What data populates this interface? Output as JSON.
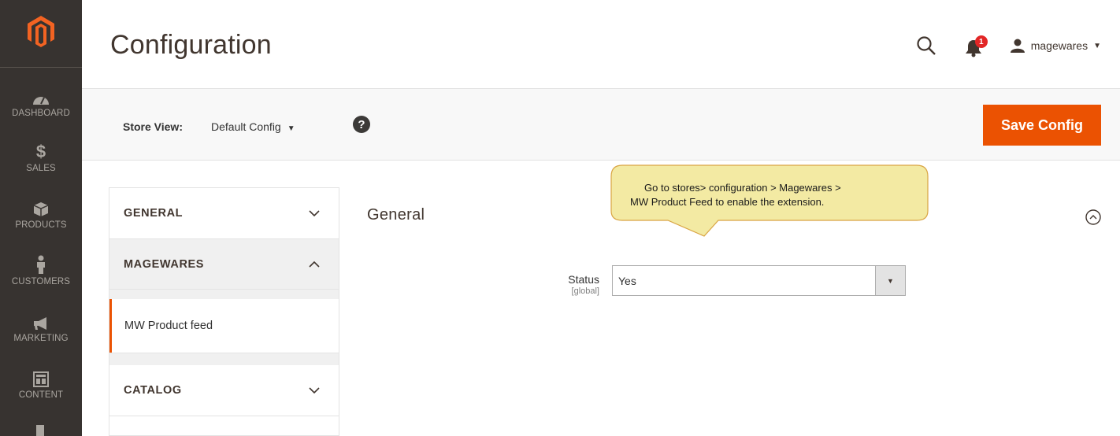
{
  "sidebar": {
    "items": [
      {
        "label": "DASHBOARD",
        "icon": "dashboard-icon"
      },
      {
        "label": "SALES",
        "icon": "dollar-icon"
      },
      {
        "label": "PRODUCTS",
        "icon": "box-icon"
      },
      {
        "label": "CUSTOMERS",
        "icon": "person-icon"
      },
      {
        "label": "MARKETING",
        "icon": "megaphone-icon"
      },
      {
        "label": "CONTENT",
        "icon": "layout-icon"
      }
    ]
  },
  "header": {
    "title": "Configuration",
    "notification_count": "1",
    "username": "magewares"
  },
  "store_view": {
    "label": "Store View:",
    "value": "Default Config",
    "help_glyph": "?"
  },
  "toolbar": {
    "save_label": "Save Config"
  },
  "tabs": {
    "general": "GENERAL",
    "magewares": "MAGEWARES",
    "magewares_item": "MW Product feed",
    "catalog": "CATALOG"
  },
  "main": {
    "fieldset_title": "General",
    "status": {
      "label": "Status",
      "scope": "[global]",
      "value": "Yes"
    }
  },
  "callout": {
    "line1": "Go to stores> configuration > Magewares >",
    "line2": "MW Product Feed to enable the extension."
  },
  "colors": {
    "accent": "#eb5202",
    "sidebar": "#373330",
    "callout_fill": "#f3eaa3",
    "callout_border": "#d9a544"
  }
}
